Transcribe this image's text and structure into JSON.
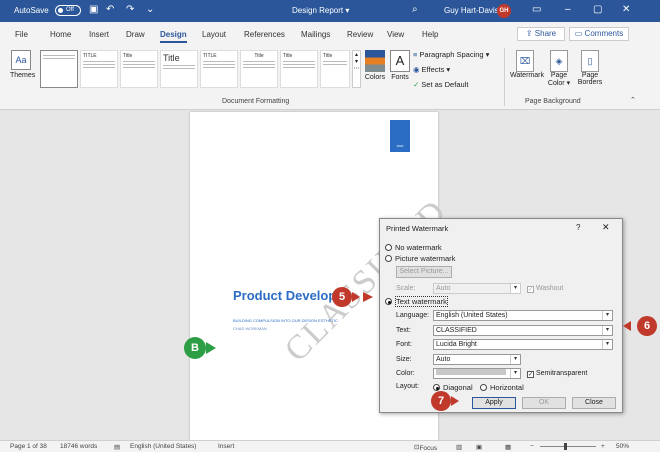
{
  "titlebar": {
    "autosave_label": "AutoSave",
    "autosave_state": "Off",
    "doc_title": "Design Report ▾",
    "user_name": "Guy Hart-Davis",
    "user_initials": "GH",
    "icons": [
      "save-icon",
      "undo-icon",
      "redo-icon",
      "search-icon",
      "ribbon-display-icon",
      "minimize-icon",
      "maximize-icon",
      "close-icon"
    ]
  },
  "menu": {
    "tabs": [
      "File",
      "Home",
      "Insert",
      "Draw",
      "Design",
      "Layout",
      "References",
      "Mailings",
      "Review",
      "View",
      "Help"
    ],
    "active": "Design",
    "share_label": "Share",
    "comments_label": "Comments"
  },
  "ribbon": {
    "themes_label": "Themes",
    "gallery": [
      {
        "title": "",
        "style": "blank"
      },
      {
        "title": "TITLE",
        "style": "title-caps"
      },
      {
        "title": "Title",
        "style": "title"
      },
      {
        "title": "Title",
        "style": "title-large"
      },
      {
        "title": "TITLE",
        "style": "title-caps"
      },
      {
        "title": "Title",
        "style": "title-centered"
      },
      {
        "title": "Title",
        "style": "title"
      },
      {
        "title": "Title",
        "style": "title"
      }
    ],
    "colors_label": "Colors",
    "fonts_label": "Fonts",
    "paragraph_spacing": "Paragraph Spacing ▾",
    "effects": "Effects ▾",
    "set_default": "Set as Default",
    "doc_formatting_label": "Document Formatting",
    "watermark_label": "Watermark",
    "page_color_label": "Page Color ▾",
    "page_borders_label": "Page Borders",
    "page_background_label": "Page Background"
  },
  "document": {
    "cover_tag": "2020",
    "watermark_text": "CLASSIFIED",
    "heading": "Product Develop",
    "subtitle": "BUILDING COMPULSION INTO OUR DESIGN ESTHETIC",
    "subtitle2": "CHAD WORKMAN"
  },
  "dialog": {
    "title": "Printed Watermark",
    "help": "?",
    "close": "✕",
    "no_watermark": "No watermark",
    "picture_watermark": "Picture watermark",
    "select_picture": "Select Picture...",
    "scale_label": "Scale:",
    "scale_value": "Auto",
    "washout_label": "Washout",
    "text_watermark": "Text watermark",
    "language_label": "Language:",
    "language_value": "English (United States)",
    "text_label": "Text:",
    "text_value": "CLASSIFIED",
    "font_label": "Font:",
    "font_value": "Lucida Bright",
    "size_label": "Size:",
    "size_value": "Auto",
    "color_label": "Color:",
    "semitransparent_label": "Semitransparent",
    "layout_label": "Layout:",
    "diagonal_label": "Diagonal",
    "horizontal_label": "Horizontal",
    "apply_label": "Apply",
    "ok_label": "OK",
    "close_label": "Close"
  },
  "callouts": {
    "five": "5",
    "six": "6",
    "seven": "7",
    "b": "B"
  },
  "statusbar": {
    "page": "Page 1 of 38",
    "words": "18746 words",
    "language": "English (United States)",
    "mode": "Insert",
    "focus": "Focus",
    "zoom": "50%"
  },
  "colors": {
    "word_blue": "#2b579a",
    "callout_red": "#c0392b",
    "callout_green": "#2e9e46",
    "doc_blue": "#2b6cc4"
  }
}
